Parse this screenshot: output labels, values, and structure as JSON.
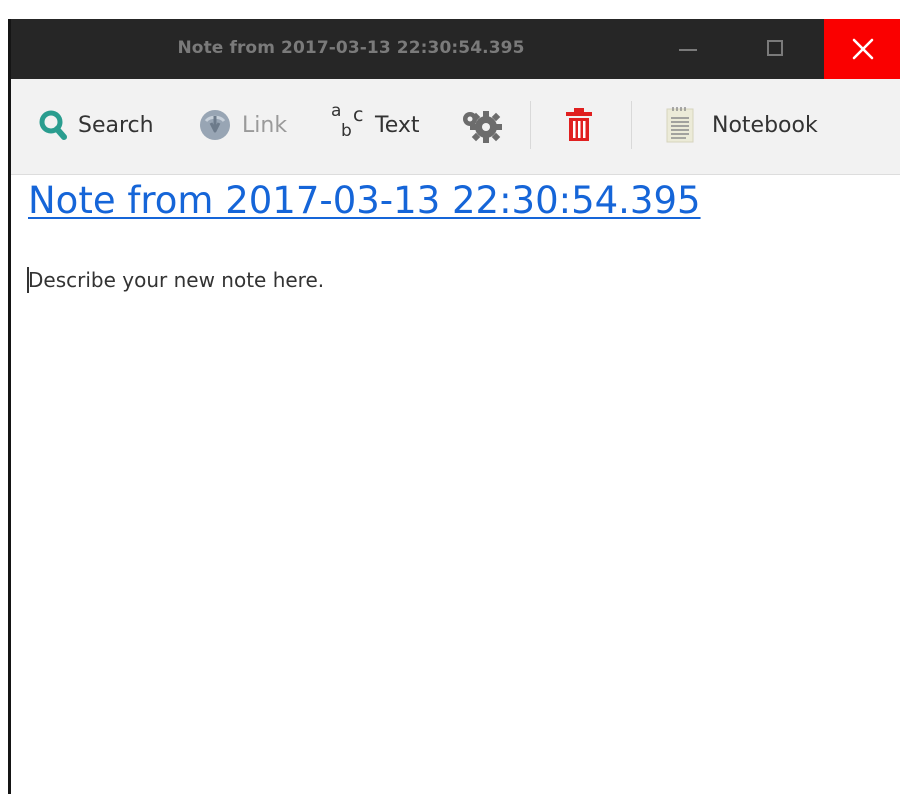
{
  "window": {
    "title": "Note from 2017-03-13 22:30:54.395"
  },
  "toolbar": {
    "search_label": "Search",
    "link_label": "Link",
    "text_label": "Text",
    "notebook_label": "Notebook"
  },
  "note": {
    "title": "Note from 2017-03-13 22:30:54.395",
    "body": "Describe your new note here."
  },
  "colors": {
    "titlebar": "#262626",
    "close_button": "#fa0000",
    "toolbar_bg": "#f2f2f2",
    "link_blue": "#1565d8",
    "search_icon": "#2a9d8f",
    "delete_icon": "#e02020"
  },
  "icons": {
    "search": "search-icon",
    "link": "link-icon",
    "text": "text-format-icon",
    "settings": "gears-icon",
    "delete": "trash-icon",
    "notebook": "notebook-icon"
  }
}
